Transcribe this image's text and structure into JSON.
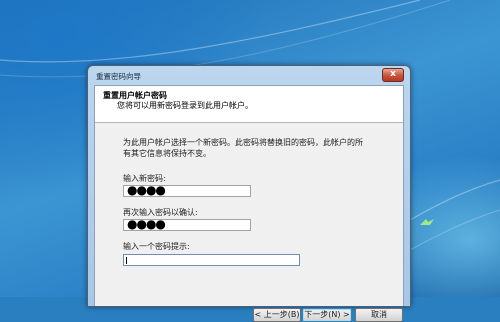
{
  "dialog": {
    "title": "重置密码向导",
    "close_label": "x",
    "header_title": "重置用户帐户密码",
    "header_subtitle": "您将可以用新密码登录到此用户帐户。",
    "description_line1": "为此用户帐户选择一个新密码。此密码将替换旧的密码，此帐户的所",
    "description_line2": "有其它信息将保持不变。",
    "new_password_label": "输入新密码:",
    "new_password_value": "●●●●",
    "confirm_password_label": "再次输入密码以确认:",
    "confirm_password_value": "●●●●",
    "hint_label": "输入一个密码提示:",
    "hint_value": "",
    "back_button": "< 上一步(B)",
    "next_button": "下一步(N) >",
    "cancel_button": "取消"
  }
}
